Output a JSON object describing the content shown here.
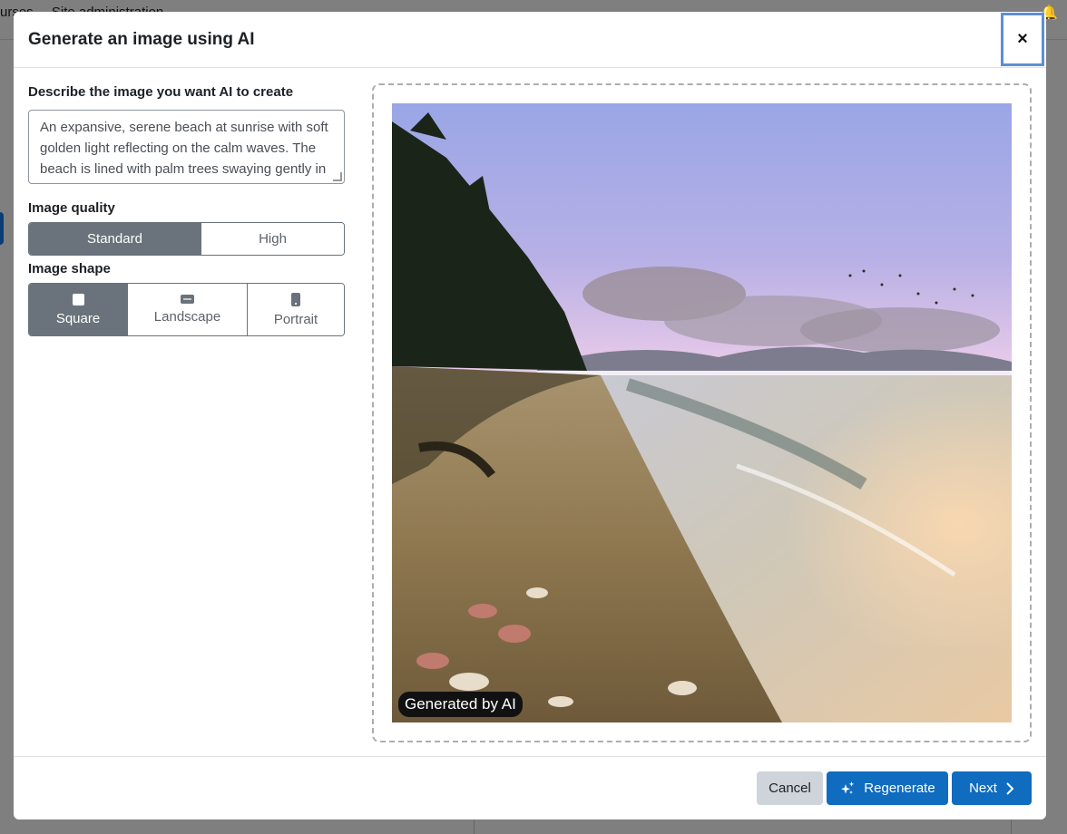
{
  "background": {
    "nav_items": [
      "urses",
      "Site administration"
    ]
  },
  "modal": {
    "title": "Generate an image using AI",
    "close_label": "×",
    "describe_label": "Describe the image you want AI to create",
    "prompt_text": "An expansive, serene beach at sunrise with soft golden light reflecting on the calm waves. The beach is lined with palm trees swaying gently in the breeze, with soft sand, shells scattered along",
    "quality_label": "Image quality",
    "quality_options": [
      "Standard",
      "High"
    ],
    "quality_selected": "Standard",
    "shape_label": "Image shape",
    "shape_options": [
      "Square",
      "Landscape",
      "Portrait"
    ],
    "shape_selected": "Square",
    "image_badge": "Generated by AI",
    "footer": {
      "cancel": "Cancel",
      "regenerate": "Regenerate",
      "next": "Next"
    }
  },
  "colors": {
    "primary": "#0f6cbf",
    "selected_toggle": "#6a737b",
    "secondary_button": "#ced4da",
    "focus_ring": "#5a8fd6"
  }
}
